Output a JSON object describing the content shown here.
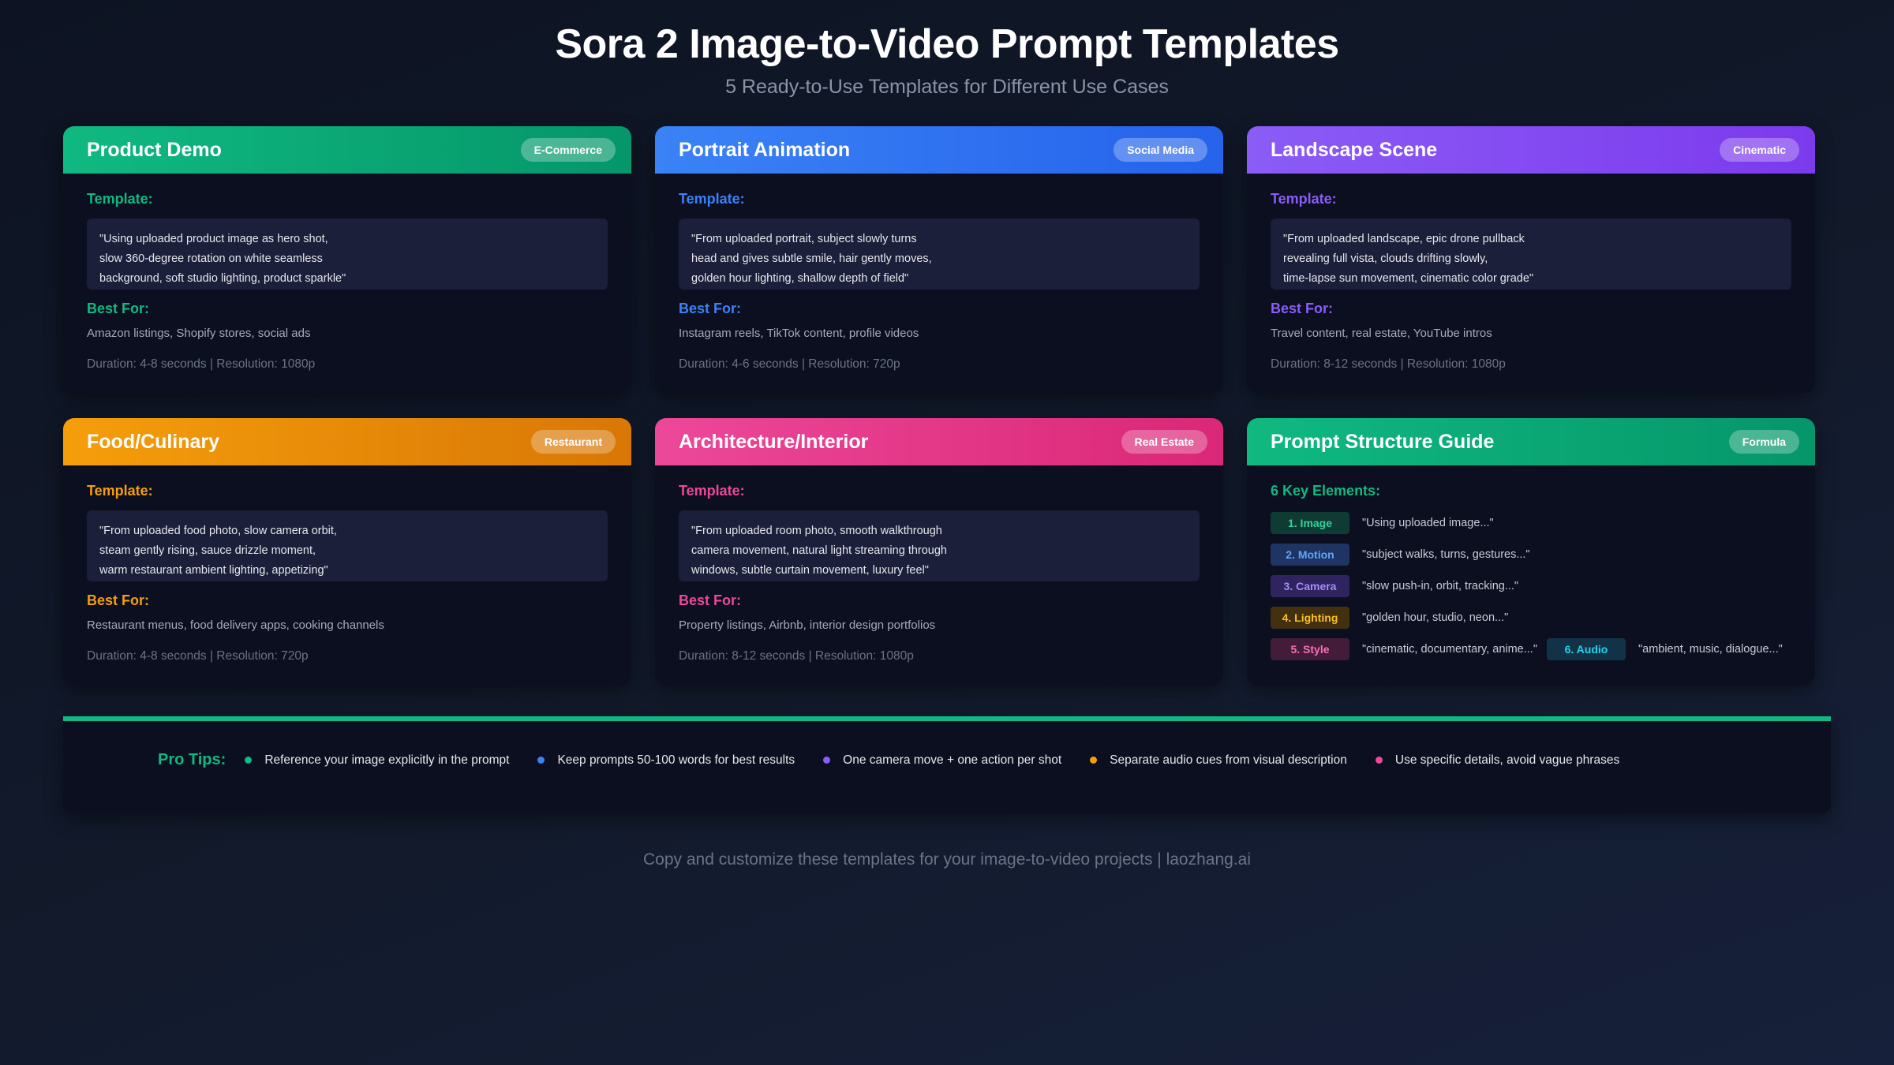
{
  "header": {
    "title": "Sora 2 Image-to-Video Prompt Templates",
    "subtitle": "5 Ready-to-Use Templates for Different Use Cases"
  },
  "colors": {
    "green": "#10b981",
    "blue": "#3b82f6",
    "purple": "#8b5cf6",
    "orange": "#f59e0b",
    "pink": "#ec4899"
  },
  "cards": [
    {
      "title": "Product Demo",
      "tag": "E-Commerce",
      "template_label": "Template:",
      "template_lines": [
        "\"Using uploaded product image as hero shot,",
        "slow 360-degree rotation on white seamless",
        "background, soft studio lighting, product sparkle\""
      ],
      "best_label": "Best For:",
      "best_for": "Amazon listings, Shopify stores, social ads",
      "meta": "Duration: 4-8 seconds | Resolution: 1080p"
    },
    {
      "title": "Portrait Animation",
      "tag": "Social Media",
      "template_label": "Template:",
      "template_lines": [
        "\"From uploaded portrait, subject slowly turns",
        "head and gives subtle smile, hair gently moves,",
        "golden hour lighting, shallow depth of field\""
      ],
      "best_label": "Best For:",
      "best_for": "Instagram reels, TikTok content, profile videos",
      "meta": "Duration: 4-6 seconds | Resolution: 720p"
    },
    {
      "title": "Landscape Scene",
      "tag": "Cinematic",
      "template_label": "Template:",
      "template_lines": [
        "\"From uploaded landscape, epic drone pullback",
        "revealing full vista, clouds drifting slowly,",
        "time-lapse sun movement, cinematic color grade\""
      ],
      "best_label": "Best For:",
      "best_for": "Travel content, real estate, YouTube intros",
      "meta": "Duration: 8-12 seconds | Resolution: 1080p"
    },
    {
      "title": "Food/Culinary",
      "tag": "Restaurant",
      "template_label": "Template:",
      "template_lines": [
        "\"From uploaded food photo, slow camera orbit,",
        "steam gently rising, sauce drizzle moment,",
        "warm restaurant ambient lighting, appetizing\""
      ],
      "best_label": "Best For:",
      "best_for": "Restaurant menus, food delivery apps, cooking channels",
      "meta": "Duration: 4-8 seconds | Resolution: 720p"
    },
    {
      "title": "Architecture/Interior",
      "tag": "Real Estate",
      "template_label": "Template:",
      "template_lines": [
        "\"From uploaded room photo, smooth walkthrough",
        "camera movement, natural light streaming through",
        "windows, subtle curtain movement, luxury feel\""
      ],
      "best_label": "Best For:",
      "best_for": "Property listings, Airbnb, interior design portfolios",
      "meta": "Duration: 8-12 seconds | Resolution: 1080p"
    }
  ],
  "guide": {
    "title": "Prompt Structure Guide",
    "tag": "Formula",
    "heading": "6 Key Elements:",
    "elements": [
      {
        "label": "1. Image",
        "text": "\"Using uploaded image...\""
      },
      {
        "label": "2. Motion",
        "text": "\"subject walks, turns, gestures...\""
      },
      {
        "label": "3. Camera",
        "text": "\"slow push-in, orbit, tracking...\""
      },
      {
        "label": "4. Lighting",
        "text": "\"golden hour, studio, neon...\""
      },
      {
        "label": "5. Style",
        "text": "\"cinematic, documentary, anime...\""
      },
      {
        "label": "6. Audio",
        "text": "\"ambient, music, dialogue...\""
      }
    ]
  },
  "tips": {
    "label": "Pro Tips:",
    "items": [
      "Reference your image explicitly in the prompt",
      "Keep prompts 50-100 words for best results",
      "One camera move + one action per shot",
      "Separate audio cues from visual description",
      "Use specific details, avoid vague phrases"
    ]
  },
  "footer": "Copy and customize these templates for your image-to-video projects | laozhang.ai"
}
